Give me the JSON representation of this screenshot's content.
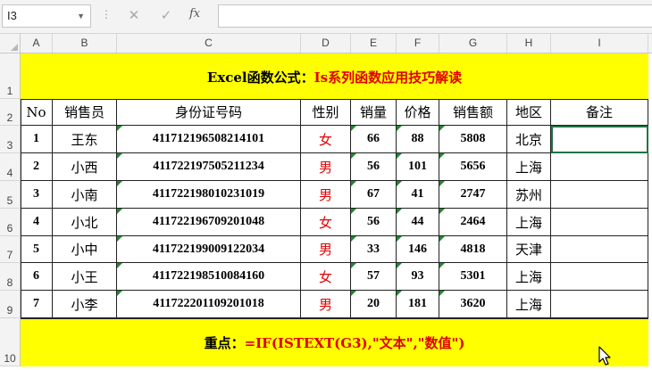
{
  "formula_bar": {
    "name_box": "I3",
    "cancel_icon": "✕",
    "enter_icon": "✓",
    "fx_label": "fx",
    "formula": ""
  },
  "columns": [
    "A",
    "B",
    "C",
    "D",
    "E",
    "F",
    "G",
    "H",
    "I"
  ],
  "row_numbers": [
    "1",
    "2",
    "3",
    "4",
    "5",
    "6",
    "7",
    "8",
    "9",
    "10"
  ],
  "title": {
    "black_part": "Excel函数公式：",
    "red_part": "Is系列函数应用技巧解读"
  },
  "table": {
    "headers": [
      "No",
      "销售员",
      "身份证号码",
      "性别",
      "销量",
      "价格",
      "销售额",
      "地区",
      "备注"
    ],
    "rows": [
      [
        "1",
        "王东",
        "411712196508214101",
        "女",
        "66",
        "88",
        "5808",
        "北京",
        ""
      ],
      [
        "2",
        "小西",
        "411722197505211234",
        "男",
        "56",
        "101",
        "5656",
        "上海",
        ""
      ],
      [
        "3",
        "小南",
        "411722198010231019",
        "男",
        "67",
        "41",
        "2747",
        "苏州",
        ""
      ],
      [
        "4",
        "小北",
        "411722196709201048",
        "女",
        "56",
        "44",
        "2464",
        "上海",
        ""
      ],
      [
        "5",
        "小中",
        "411722199009122034",
        "男",
        "33",
        "146",
        "4818",
        "天津",
        ""
      ],
      [
        "6",
        "小王",
        "411722198510084160",
        "女",
        "57",
        "93",
        "5301",
        "上海",
        ""
      ],
      [
        "7",
        "小李",
        "411722201109201018",
        "男",
        "20",
        "181",
        "3620",
        "上海",
        ""
      ]
    ]
  },
  "note": {
    "black_part": "重点：",
    "red_part": "=IF(ISTEXT(G3),\"文本\",\"数值\")"
  },
  "colors": {
    "band": "#ffff00",
    "accent_red": "#e00000",
    "error_triangle": "#1e8a2e"
  }
}
